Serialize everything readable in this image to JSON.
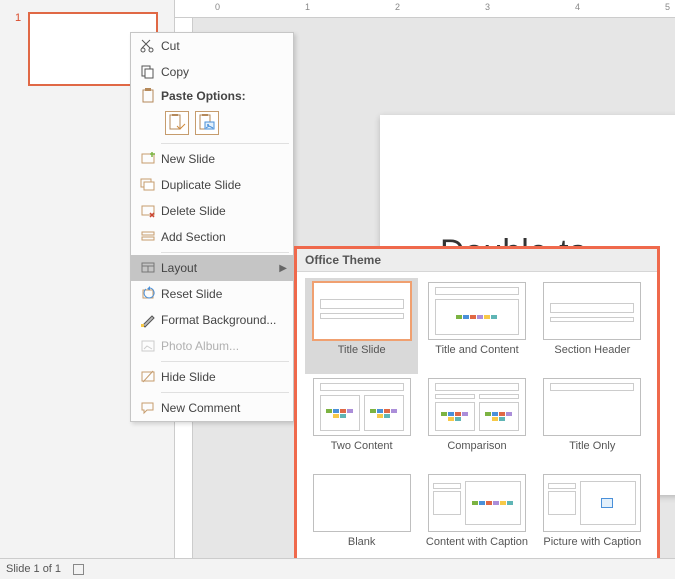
{
  "thumb": {
    "number": "1"
  },
  "ruler": {
    "ticks": [
      "0",
      "1",
      "2",
      "3",
      "4",
      "5"
    ]
  },
  "canvas": {
    "text": "Double-ta"
  },
  "statusbar": {
    "slide": "Slide 1 of 1"
  },
  "context_menu": {
    "cut": "Cut",
    "copy": "Copy",
    "paste_options": "Paste Options:",
    "new_slide": "New Slide",
    "duplicate_slide": "Duplicate Slide",
    "delete_slide": "Delete Slide",
    "add_section": "Add Section",
    "layout": "Layout",
    "reset_slide": "Reset Slide",
    "format_bg": "Format Background...",
    "photo_album": "Photo Album...",
    "hide_slide": "Hide Slide",
    "new_comment": "New Comment"
  },
  "layout_flyout": {
    "header": "Office Theme",
    "items": [
      {
        "label": "Title Slide",
        "selected": true,
        "kind": "title"
      },
      {
        "label": "Title and Content",
        "selected": false,
        "kind": "content"
      },
      {
        "label": "Section Header",
        "selected": false,
        "kind": "section"
      },
      {
        "label": "Two Content",
        "selected": false,
        "kind": "two"
      },
      {
        "label": "Comparison",
        "selected": false,
        "kind": "compare"
      },
      {
        "label": "Title Only",
        "selected": false,
        "kind": "titleonly"
      },
      {
        "label": "Blank",
        "selected": false,
        "kind": "blank"
      },
      {
        "label": "Content with Caption",
        "selected": false,
        "kind": "capcontent"
      },
      {
        "label": "Picture with Caption",
        "selected": false,
        "kind": "cappic"
      }
    ]
  }
}
